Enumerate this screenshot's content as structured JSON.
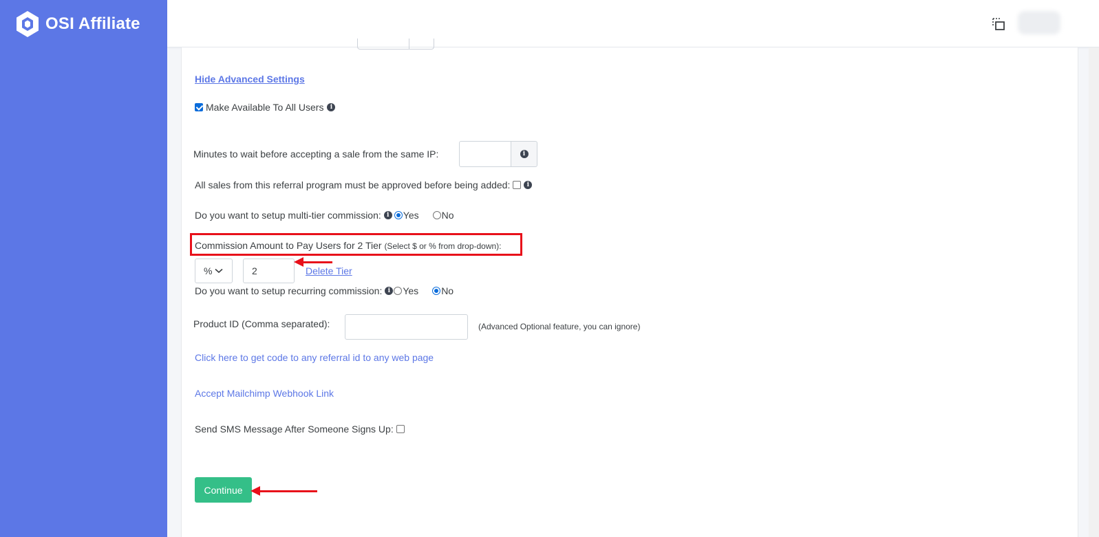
{
  "brand": {
    "name": "OSI Affiliate",
    "color": "#5c77e6"
  },
  "topbar": {
    "copy_icon": "copy-icon"
  },
  "settings": {
    "hide_advanced_link": "Hide Advanced Settings",
    "make_available_label": "Make Available To All Users",
    "make_available_checked": true,
    "minutes_wait_label": "Minutes to wait before accepting a sale from the same IP:",
    "minutes_wait_value": "",
    "approve_sales_label": "All sales from this referral program must be approved before being added:",
    "approve_sales_checked": false,
    "multi_tier_label": "Do you want to setup multi-tier commission:",
    "multi_tier_options": [
      "Yes",
      "No"
    ],
    "multi_tier_selected": "Yes",
    "commission_label_main": "Commission Amount to Pay Users for 2 Tier",
    "commission_label_hint": "(Select $ or % from drop-down):",
    "commission_type_selected": "%",
    "commission_amount_value": "2",
    "delete_tier_link": "Delete Tier",
    "recurring_label": "Do you want to setup recurring commission:",
    "recurring_options": [
      "Yes",
      "No"
    ],
    "recurring_selected": "No",
    "product_id_label": "Product ID (Comma separated):",
    "product_id_value": "",
    "product_id_hint": "(Advanced Optional feature, you can ignore)",
    "referral_code_link": "Click here to get code to any referral id to any web page",
    "mailchimp_link": "Accept Mailchimp Webhook Link",
    "sms_label": "Send SMS Message After Someone Signs Up:",
    "sms_checked": false,
    "continue_label": "Continue"
  },
  "colors": {
    "accent_button": "#34bf88",
    "annotation": "#e8101a"
  }
}
